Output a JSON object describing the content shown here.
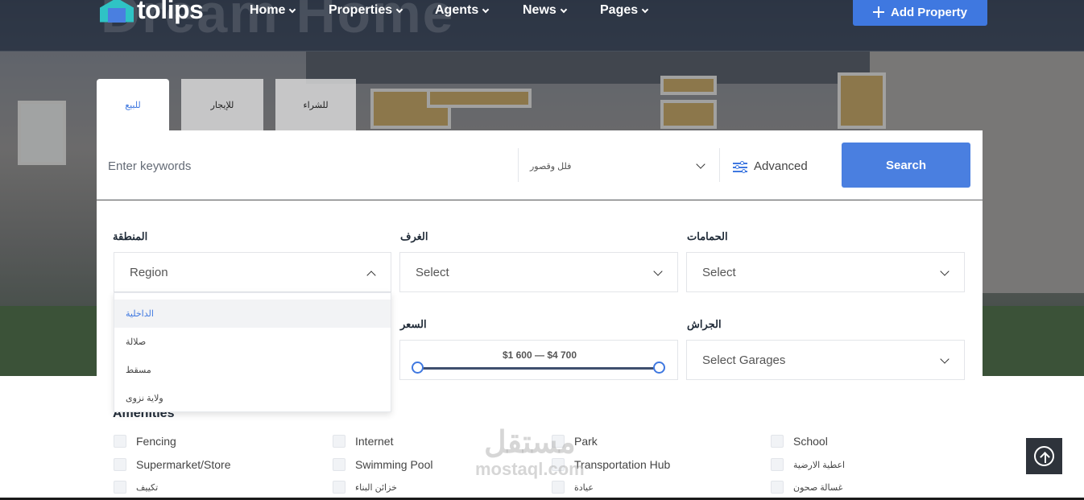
{
  "brand": {
    "name": "tolips",
    "hero_word": "Dream Home"
  },
  "nav": {
    "items": [
      "Home",
      "Properties",
      "Agents",
      "News",
      "Pages"
    ],
    "add_property": "Add Property"
  },
  "tabs": [
    "للبيع",
    "للإيجار",
    "للشراء"
  ],
  "search": {
    "keywords_placeholder": "Enter keywords",
    "type_value": "فلل وقصور",
    "advanced_label": "Advanced",
    "search_button": "Search"
  },
  "filters": {
    "region_label": "المنطقة",
    "region_value": "Region",
    "rooms_label": "الغرف",
    "rooms_value": "Select",
    "baths_label": "الحمامات",
    "baths_value": "Select",
    "price_label": "السعر",
    "price_text": "$1 600 — $4 700",
    "price_range": {
      "min": 1600,
      "max": 4700
    },
    "garage_label": "الجراش",
    "garage_value": "Select Garages",
    "region_options": [
      "الداخلية",
      "صلالة",
      "مسقط",
      "ولاية نزوى"
    ]
  },
  "amenities": {
    "title": "Amenities",
    "items": [
      "Fencing",
      "Internet",
      "Park",
      "School",
      "Supermarket/Store",
      "Swimming Pool",
      "Transportation Hub",
      "اعطية الارضية",
      "تكييف",
      "خزائن البناء",
      "عيادة",
      "غسالة صحون"
    ]
  },
  "watermark": {
    "arabic": "مستقل",
    "latin": "mostaql.com"
  },
  "colors": {
    "accent": "#3f78e0",
    "dark": "#2e333b",
    "teal": "#2fc3c5"
  },
  "icons": {
    "advanced": "sliders-icon",
    "scroll_top": "arrow-up-circle-icon",
    "add": "plus-icon"
  }
}
